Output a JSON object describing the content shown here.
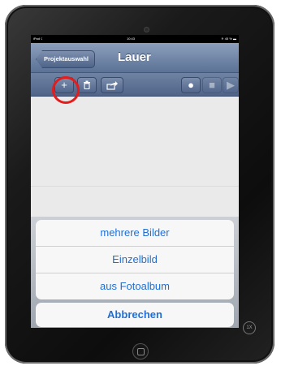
{
  "status_bar": {
    "carrier": "iPad ☇",
    "time": "10:43",
    "battery": "✳ 45 % ▬"
  },
  "navbar": {
    "back_label": "Projektauswahl",
    "title": "Lauer"
  },
  "toolbar": {
    "buttons": [
      {
        "name": "add",
        "glyph": "+"
      },
      {
        "name": "trash",
        "glyph": "🗑"
      },
      {
        "name": "share",
        "glyph": "↪"
      },
      {
        "name": "record",
        "glyph": "●"
      },
      {
        "name": "stop",
        "glyph": "■"
      },
      {
        "name": "play",
        "glyph": "▶"
      }
    ]
  },
  "action_sheet": {
    "items": [
      "mehrere Bilder",
      "Einzelbild",
      "aus Fotoalbum"
    ],
    "cancel": "Abbrechen"
  },
  "zoom_label": "1X",
  "colors": {
    "highlight": "#e31c1c",
    "sheet_text": "#1f6fd6",
    "navbar": "#5b7296"
  }
}
